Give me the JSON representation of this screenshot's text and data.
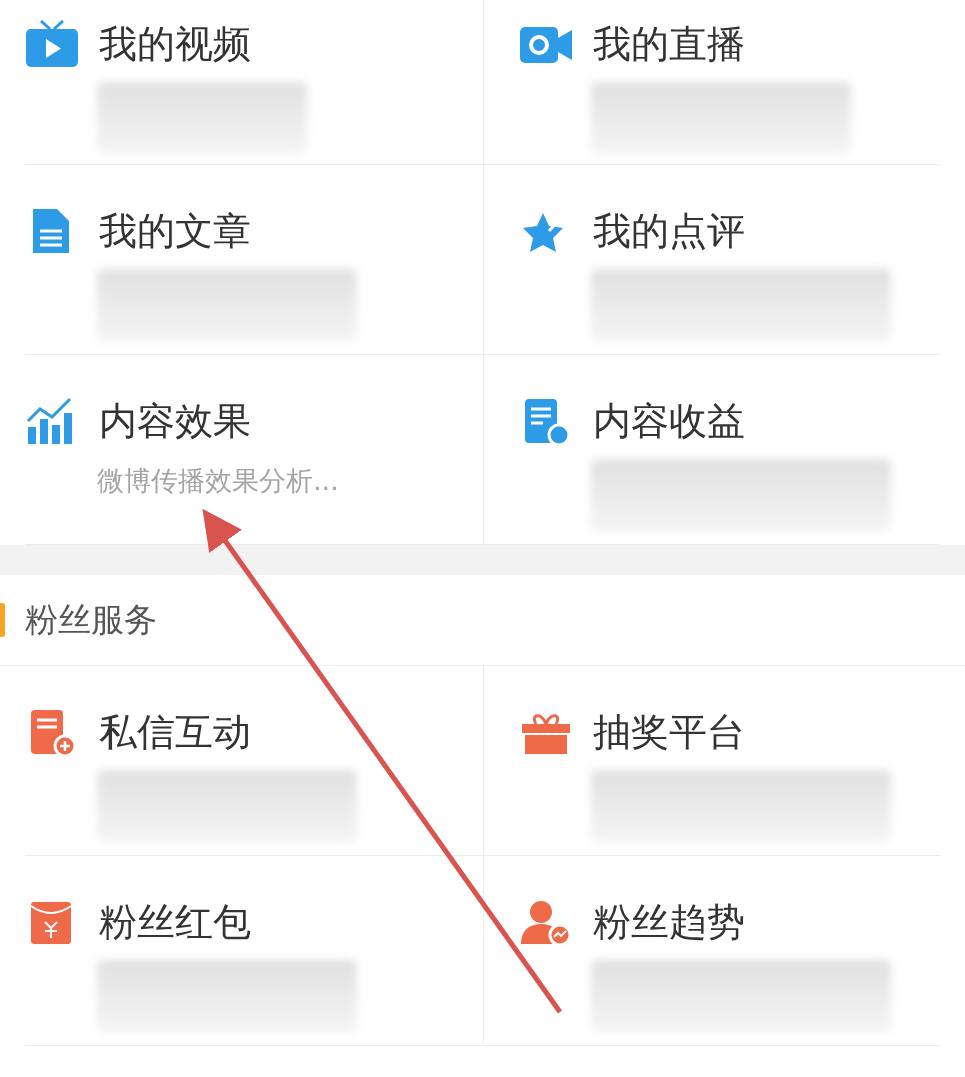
{
  "sections": [
    {
      "tiles": [
        {
          "title": "我的视频",
          "blurred": true
        },
        {
          "title": "我的直播",
          "blurred": true
        },
        {
          "title": "我的文章",
          "blurred": true
        },
        {
          "title": "我的点评",
          "blurred": true
        },
        {
          "title": "内容效果",
          "subtitle": "微博传播效果分析...",
          "blurred": false
        },
        {
          "title": "内容收益",
          "blurred": true
        }
      ]
    },
    {
      "header": "粉丝服务",
      "tiles": [
        {
          "title": "私信互动",
          "blurred": true
        },
        {
          "title": "抽奖平台",
          "blurred": true
        },
        {
          "title": "粉丝红包",
          "blurred": true
        },
        {
          "title": "粉丝趋势",
          "blurred": true
        }
      ]
    }
  ]
}
